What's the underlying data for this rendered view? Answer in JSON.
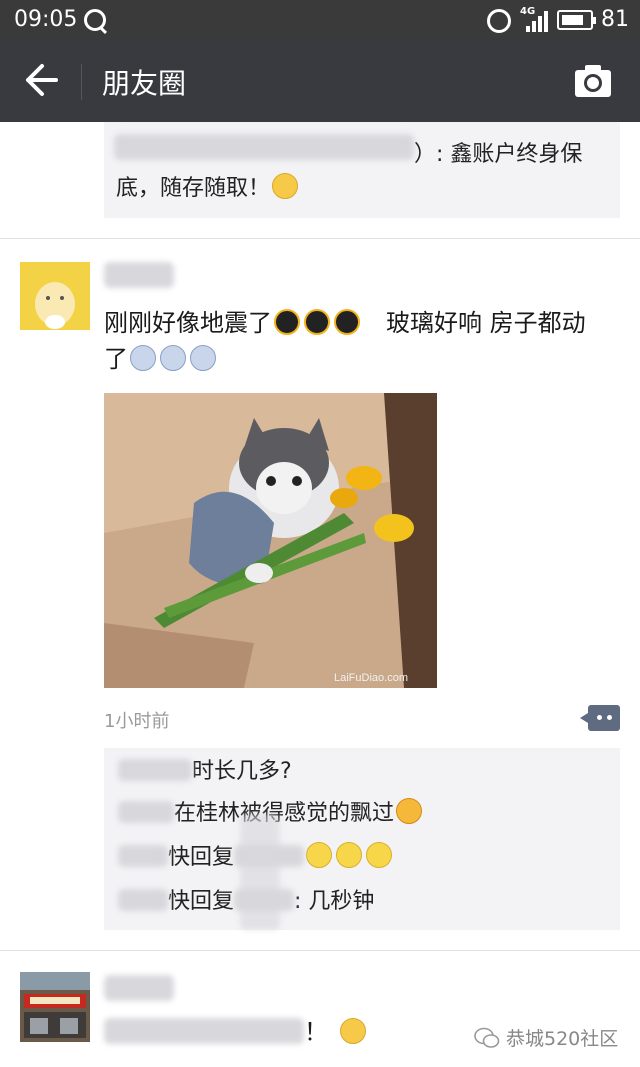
{
  "status": {
    "time": "09:05",
    "network": "4G",
    "battery_level": "81",
    "battery_fraction": 0.81
  },
  "nav": {
    "title": "朋友圈"
  },
  "prev_comment": {
    "line1_tail": "）: 鑫账户终身保",
    "line2": "底，随存随取！"
  },
  "post1": {
    "text_line1": "刚刚好像地震了",
    "text_line1_tail": "玻璃好响  房子都动",
    "text_line2": "了",
    "image_watermark": "LaiFuDiao.com",
    "time_ago": "1小时前",
    "replies": [
      {
        "text": "时长几多?"
      },
      {
        "text": "在桂林被得感觉的飘过"
      },
      {
        "text": "快回复"
      },
      {
        "text": "快回复",
        "tail": ": 几秒钟"
      }
    ]
  },
  "post2": {
    "text_tail": "！"
  },
  "watermark": {
    "text": "恭城520社区"
  },
  "icons": [
    "back-arrow-icon",
    "camera-icon",
    "comment-more-icon",
    "alarm-icon",
    "signal-icon",
    "battery-icon"
  ]
}
